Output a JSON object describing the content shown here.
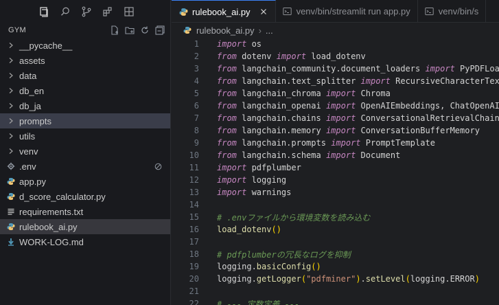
{
  "explorer": {
    "root_label": "GYM",
    "items": [
      {
        "label": "__pycache__",
        "kind": "folder"
      },
      {
        "label": "assets",
        "kind": "folder"
      },
      {
        "label": "data",
        "kind": "folder"
      },
      {
        "label": "db_en",
        "kind": "folder"
      },
      {
        "label": "db_ja",
        "kind": "folder"
      },
      {
        "label": "prompts",
        "kind": "folder"
      },
      {
        "label": "utils",
        "kind": "folder"
      },
      {
        "label": "venv",
        "kind": "folder"
      },
      {
        "label": ".env",
        "kind": "settings"
      },
      {
        "label": "app.py",
        "kind": "python"
      },
      {
        "label": "d_score_calculator.py",
        "kind": "python"
      },
      {
        "label": "requirements.txt",
        "kind": "text"
      },
      {
        "label": "rulebook_ai.py",
        "kind": "python"
      },
      {
        "label": "WORK-LOG.md",
        "kind": "markdown"
      }
    ]
  },
  "tabs": [
    {
      "label": "rulebook_ai.py",
      "active": true
    },
    {
      "label": "venv/bin/streamlit run app.py",
      "active": false
    },
    {
      "label": "venv/bin/s",
      "active": false
    }
  ],
  "breadcrumb": {
    "file": "rulebook_ai.py",
    "more": "..."
  },
  "code": {
    "line_numbers": [
      "1",
      "2",
      "3",
      "4",
      "5",
      "6",
      "7",
      "8",
      "9",
      "10",
      "11",
      "12",
      "13",
      "14",
      "15",
      "16",
      "17",
      "18",
      "19",
      "20",
      "21",
      "22"
    ],
    "l1": {
      "kw": "import",
      "rest": " os"
    },
    "l2": {
      "kw": "from",
      "mod": " dotenv ",
      "kw2": "import",
      "rest": " load_dotenv"
    },
    "l3": {
      "kw": "from",
      "mod": " langchain_community.document_loaders ",
      "kw2": "import",
      "rest": " PyPDFLoader"
    },
    "l4": {
      "kw": "from",
      "mod": " langchain.text_splitter ",
      "kw2": "import",
      "rest": " RecursiveCharacterTextSplitter"
    },
    "l5": {
      "kw": "from",
      "mod": " langchain_chroma ",
      "kw2": "import",
      "rest": " Chroma"
    },
    "l6": {
      "kw": "from",
      "mod": " langchain_openai ",
      "kw2": "import",
      "rest": " OpenAIEmbeddings, ChatOpenAI"
    },
    "l7": {
      "kw": "from",
      "mod": " langchain.chains ",
      "kw2": "import",
      "rest": " ConversationalRetrievalChain"
    },
    "l8": {
      "kw": "from",
      "mod": " langchain.memory ",
      "kw2": "import",
      "rest": " ConversationBufferMemory"
    },
    "l9": {
      "kw": "from",
      "mod": " langchain.prompts ",
      "kw2": "import",
      "rest": " PromptTemplate"
    },
    "l10": {
      "kw": "from",
      "mod": " langchain.schema ",
      "kw2": "import",
      "rest": " Document"
    },
    "l11": {
      "kw": "import",
      "rest": " pdfplumber"
    },
    "l12": {
      "kw": "import",
      "rest": " logging"
    },
    "l13": {
      "kw": "import",
      "rest": " warnings"
    },
    "l15": {
      "comment": "# .envファイルから環境変数を読み込む"
    },
    "l16": {
      "fn": "load_dotenv",
      "open": "(",
      "close": ")"
    },
    "l18": {
      "comment": "# pdfplumberの冗長なログを抑制"
    },
    "l19": {
      "obj": "logging.",
      "fn": "basicConfig",
      "open": "(",
      "close": ")"
    },
    "l20": {
      "obj": "logging.",
      "fn": "getLogger",
      "open": "(",
      "str": "\"pdfminer\"",
      "close": ")",
      "dot": ".",
      "fn2": "setLevel",
      "open2": "(",
      "arg": "logging.ERROR",
      "close2": ")"
    },
    "l22": {
      "comment": "# --- 定数定義 ---"
    }
  },
  "colors": {
    "accent": "#3b82f6",
    "python_icon": "#519aba",
    "gear": "#8f96a0"
  }
}
